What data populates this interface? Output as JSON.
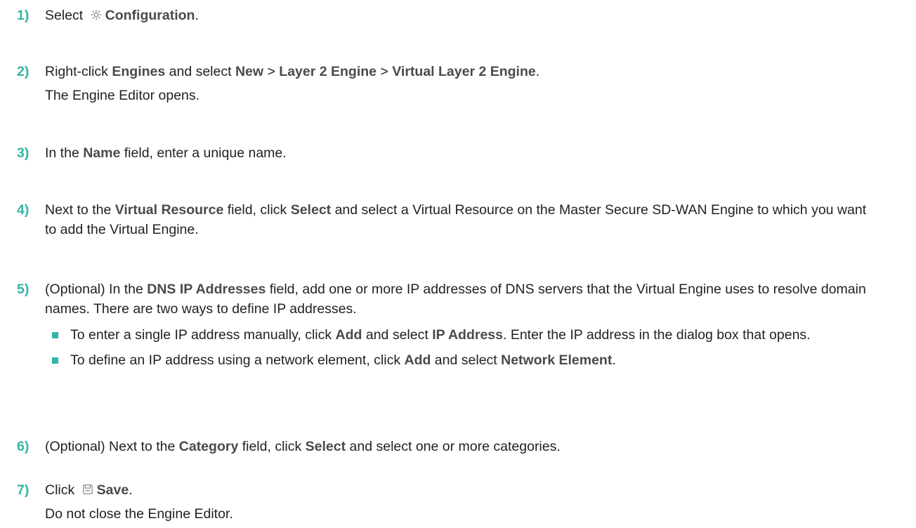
{
  "steps": [
    {
      "num": "1)",
      "parts": {
        "a": "Select",
        "b": "Configuration",
        "c": "."
      },
      "icon": "gear-icon"
    },
    {
      "num": "2)",
      "parts": {
        "a": "Right-click ",
        "b": "Engines",
        "c": " and select ",
        "d": "New",
        "e": " > ",
        "f": "Layer 2 Engine",
        "g": " > ",
        "h": "Virtual Layer 2 Engine",
        "i": "."
      },
      "result": "The Engine Editor opens."
    },
    {
      "num": "3)",
      "parts": {
        "a": "In the ",
        "b": "Name",
        "c": " field, enter a unique name."
      }
    },
    {
      "num": "4)",
      "parts": {
        "a": "Next to the ",
        "b": "Virtual Resource",
        "c": " field, click ",
        "d": "Select",
        "e": " and select a Virtual Resource on the Master Secure SD-WAN Engine to which you want to add the Virtual Engine."
      }
    },
    {
      "num": "5)",
      "parts": {
        "a": "(Optional) In the ",
        "b": "DNS IP Addresses",
        "c": " field, add one or more IP addresses of DNS servers that the Virtual Engine uses to resolve domain names. There are two ways to define IP addresses."
      },
      "bullets": [
        {
          "a": "To enter a single IP address manually, click ",
          "b": "Add",
          "c": " and select ",
          "d": "IP Address",
          "e": ". Enter the IP address in the dialog box that opens."
        },
        {
          "a": "To define an IP address using a network element, click ",
          "b": "Add",
          "c": " and select ",
          "d": "Network Element",
          "e": "."
        }
      ]
    },
    {
      "num": "6)",
      "parts": {
        "a": "(Optional) Next to the ",
        "b": "Category",
        "c": " field, click ",
        "d": "Select",
        "e": " and select one or more categories."
      }
    },
    {
      "num": "7)",
      "parts": {
        "a": "Click",
        "b": "Save",
        "c": "."
      },
      "icon": "save-icon",
      "result": "Do not close the Engine Editor."
    }
  ],
  "colors": {
    "step_number": "#33b5a3",
    "bullet": "#33b5a3",
    "text": "#222222",
    "bold_text": "#4a4a4a",
    "icon": "#9a9a9a"
  }
}
